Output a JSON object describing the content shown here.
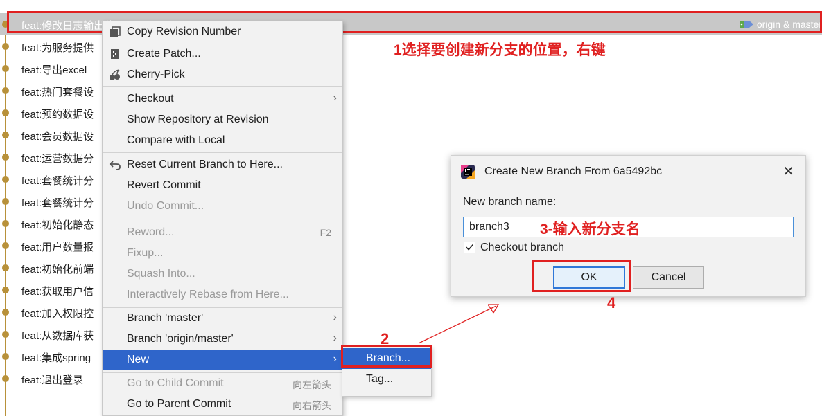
{
  "commits": [
    {
      "message": "feat:修改日志输出位置",
      "selected": true
    },
    {
      "message": "feat:为服务提供"
    },
    {
      "message": "feat:导出excel"
    },
    {
      "message": "feat:热门套餐设"
    },
    {
      "message": "feat:预约数据设"
    },
    {
      "message": "feat:会员数据设"
    },
    {
      "message": "feat:运营数据分"
    },
    {
      "message": "feat:套餐统计分"
    },
    {
      "message": "feat:套餐统计分"
    },
    {
      "message": "feat:初始化静态"
    },
    {
      "message": "feat:用户数量报"
    },
    {
      "message": "feat:初始化前端"
    },
    {
      "message": "feat:获取用户信"
    },
    {
      "message": "feat:加入权限控"
    },
    {
      "message": "feat:从数据库获"
    },
    {
      "message": "feat:集成spring"
    },
    {
      "message": "feat:退出登录"
    }
  ],
  "ref_tag": {
    "label": "origin & master",
    "icon": "tag-icon"
  },
  "context_menu": {
    "copy_revision": "Copy Revision Number",
    "create_patch": "Create Patch...",
    "cherry_pick": "Cherry-Pick",
    "checkout": "Checkout",
    "show_repo": "Show Repository at Revision",
    "compare_local": "Compare with Local",
    "reset_branch": "Reset Current Branch to Here...",
    "revert_commit": "Revert Commit",
    "undo_commit": "Undo Commit...",
    "reword": "Reword...",
    "reword_shortcut": "F2",
    "fixup": "Fixup...",
    "squash": "Squash Into...",
    "rebase": "Interactively Rebase from Here...",
    "branch_master": "Branch 'master'",
    "branch_origin_master": "Branch 'origin/master'",
    "new": "New",
    "go_child": "Go to Child Commit",
    "go_child_shortcut": "向左箭头",
    "go_parent": "Go to Parent Commit",
    "go_parent_shortcut": "向右箭头"
  },
  "submenu": {
    "branch": "Branch...",
    "tag": "Tag..."
  },
  "dialog": {
    "title": "Create New Branch From 6a5492bc",
    "close": "✕",
    "label": "New branch name:",
    "input_value": "branch3",
    "checkbox_label": "Checkout branch",
    "checkbox_checked": true,
    "ok": "OK",
    "cancel": "Cancel"
  },
  "annotations": {
    "step1": "1选择要创建新分支的位置，右键",
    "step2": "2",
    "step3": "3-输入新分支名",
    "step4": "4"
  },
  "colors": {
    "accent": "#2f65ca",
    "annotation": "#e02020",
    "graph": "#b8913a"
  }
}
